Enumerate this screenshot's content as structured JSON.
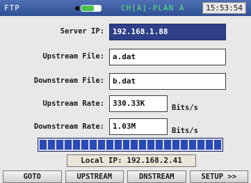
{
  "status_bar": {
    "mode": "FTP",
    "battery_level": 0.65,
    "channel": "CH[A]-PLAN A",
    "time": "15:53:54"
  },
  "form": {
    "server_ip": {
      "label": "Server IP:",
      "value": "192.168.1.88"
    },
    "upstream_file": {
      "label": "Upstream File:",
      "value": "a.dat"
    },
    "downstream_file": {
      "label": "Downstream File:",
      "value": "b.dat"
    },
    "upstream_rate": {
      "label": "Upstream Rate:",
      "value": "330.33K",
      "unit": "Bits/s"
    },
    "downstream_rate": {
      "label": "Downstream Rate:",
      "value": "1.03M",
      "unit": "Bits/s"
    }
  },
  "progress": {
    "fraction": 1.0,
    "segments": 22
  },
  "local_ip": "Local IP:  192.168.2.41",
  "softkeys": [
    "GOTO",
    "UPSTREAM",
    "DNSTREAM",
    "SETUP >>"
  ],
  "colors": {
    "status_bar": "#2f4f95",
    "highlight": "#2f3f8a",
    "progress": "#2a4ab8",
    "channel": "#55e07a"
  }
}
